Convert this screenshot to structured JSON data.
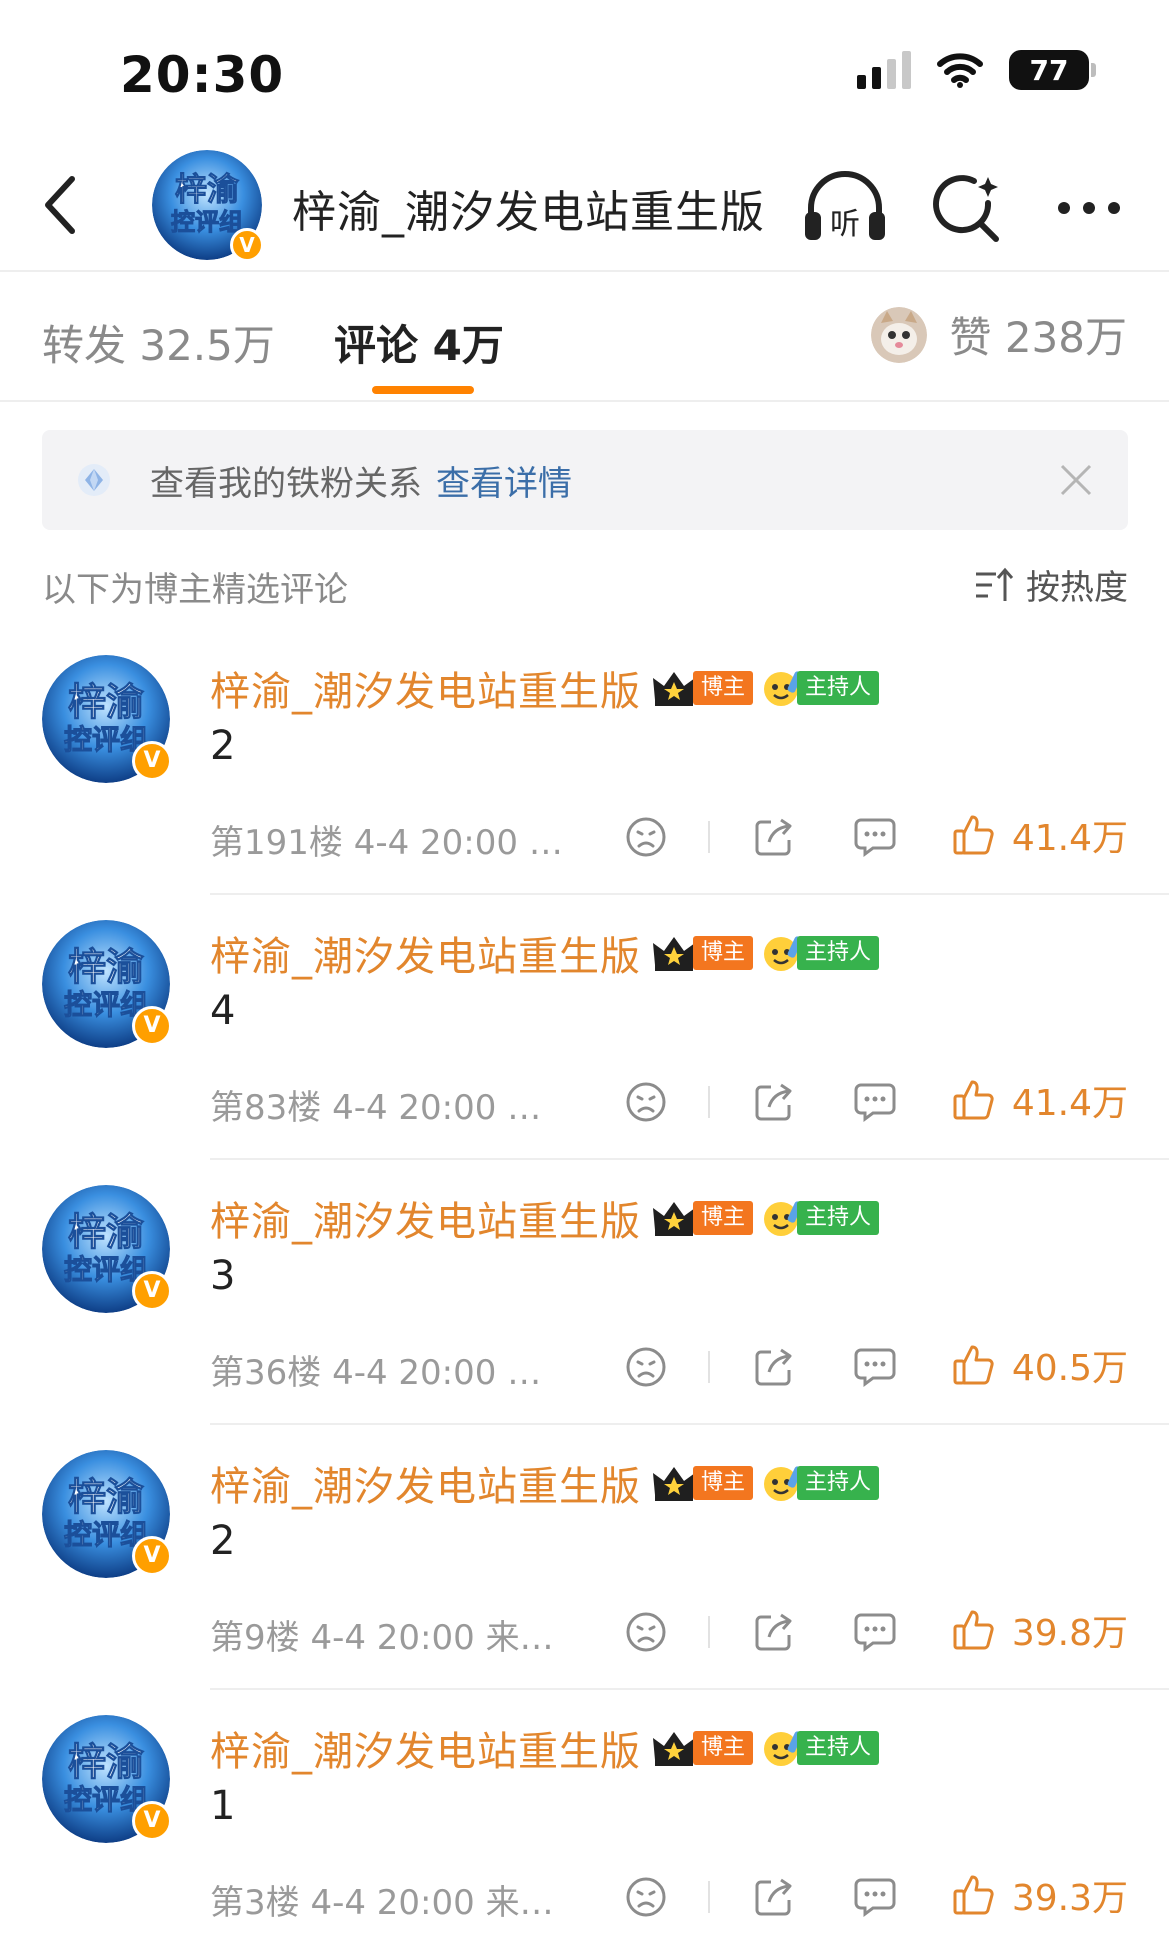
{
  "status_bar": {
    "time": "20:30",
    "battery": "77"
  },
  "header": {
    "title": "梓渝_潮汐发电站重生版",
    "listen_label": "听"
  },
  "tabs": {
    "repost_label": "转发 32.5万",
    "comment_label": "评论 4万",
    "like_label": "赞 238万"
  },
  "fan_banner": {
    "text": "查看我的铁粉关系",
    "link": "查看详情"
  },
  "section": {
    "label": "以下为博主精选评论",
    "sort_label": "按热度"
  },
  "avatar": {
    "line1": "梓渝",
    "line2": "控评组"
  },
  "badges": {
    "blogger": "博主",
    "host": "主持人"
  },
  "comments": [
    {
      "name": "梓渝_潮汐发电站重生版",
      "content": "2",
      "meta": "第191楼 4-4 20:00 …",
      "likes": "41.4万"
    },
    {
      "name": "梓渝_潮汐发电站重生版",
      "content": "4",
      "meta": "第83楼 4-4 20:00 …",
      "likes": "41.4万"
    },
    {
      "name": "梓渝_潮汐发电站重生版",
      "content": "3",
      "meta": "第36楼 4-4 20:00 …",
      "likes": "40.5万"
    },
    {
      "name": "梓渝_潮汐发电站重生版",
      "content": "2",
      "meta": "第9楼 4-4 20:00 来…",
      "likes": "39.8万"
    },
    {
      "name": "梓渝_潮汐发电站重生版",
      "content": "1",
      "meta": "第3楼 4-4 20:00 来…",
      "likes": "39.3万"
    }
  ],
  "colors": {
    "accent": "#ff8200",
    "name": "#e2862d",
    "link": "#3b6ea8",
    "blogger_tag": "#f3761f",
    "host_tag": "#37b24d"
  }
}
